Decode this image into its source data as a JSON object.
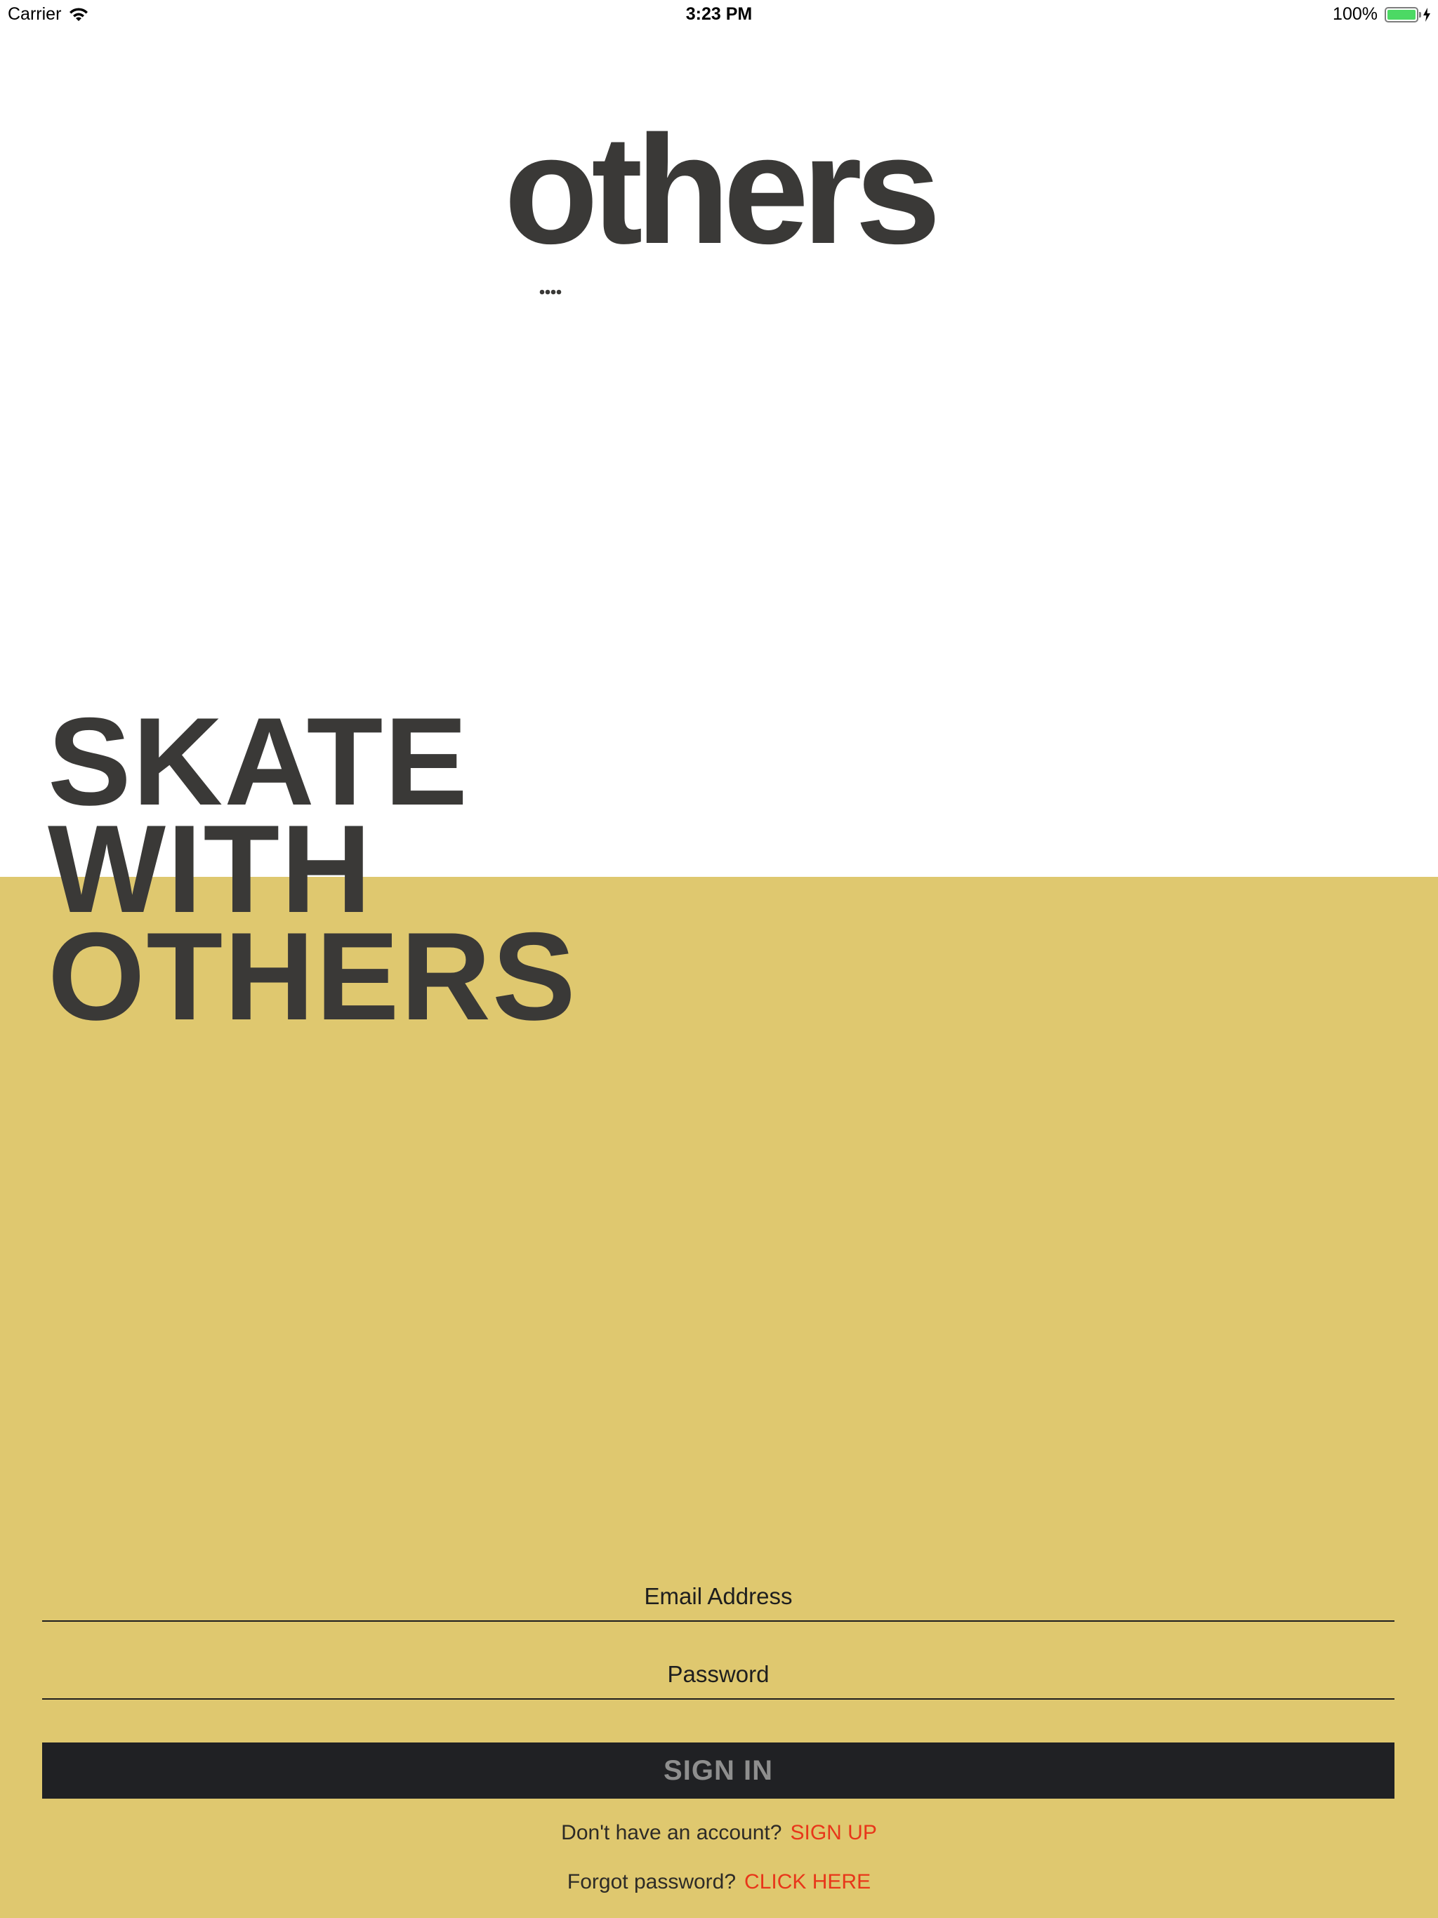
{
  "status_bar": {
    "carrier": "Carrier",
    "time": "3:23 PM",
    "battery": "100%",
    "battery_level": 1.0,
    "battery_color": "#4cd964"
  },
  "logo": {
    "text": "others",
    "icon": "chat-bubble-icon"
  },
  "headline": {
    "line1": "SKATE",
    "line2": "WITH",
    "line3": "OTHERS"
  },
  "colors": {
    "accent_background": "#dfc86f",
    "text_dark": "#3a3937",
    "button_background": "#202124",
    "link": "#e8361a"
  },
  "form": {
    "email_placeholder": "Email Address",
    "email_value": "",
    "password_placeholder": "Password",
    "password_value": "",
    "signin_label": "SIGN IN"
  },
  "signup": {
    "prompt": "Don't have an account?",
    "link": "SIGN UP"
  },
  "forgot": {
    "prompt": "Forgot password?",
    "link": "CLICK HERE"
  }
}
